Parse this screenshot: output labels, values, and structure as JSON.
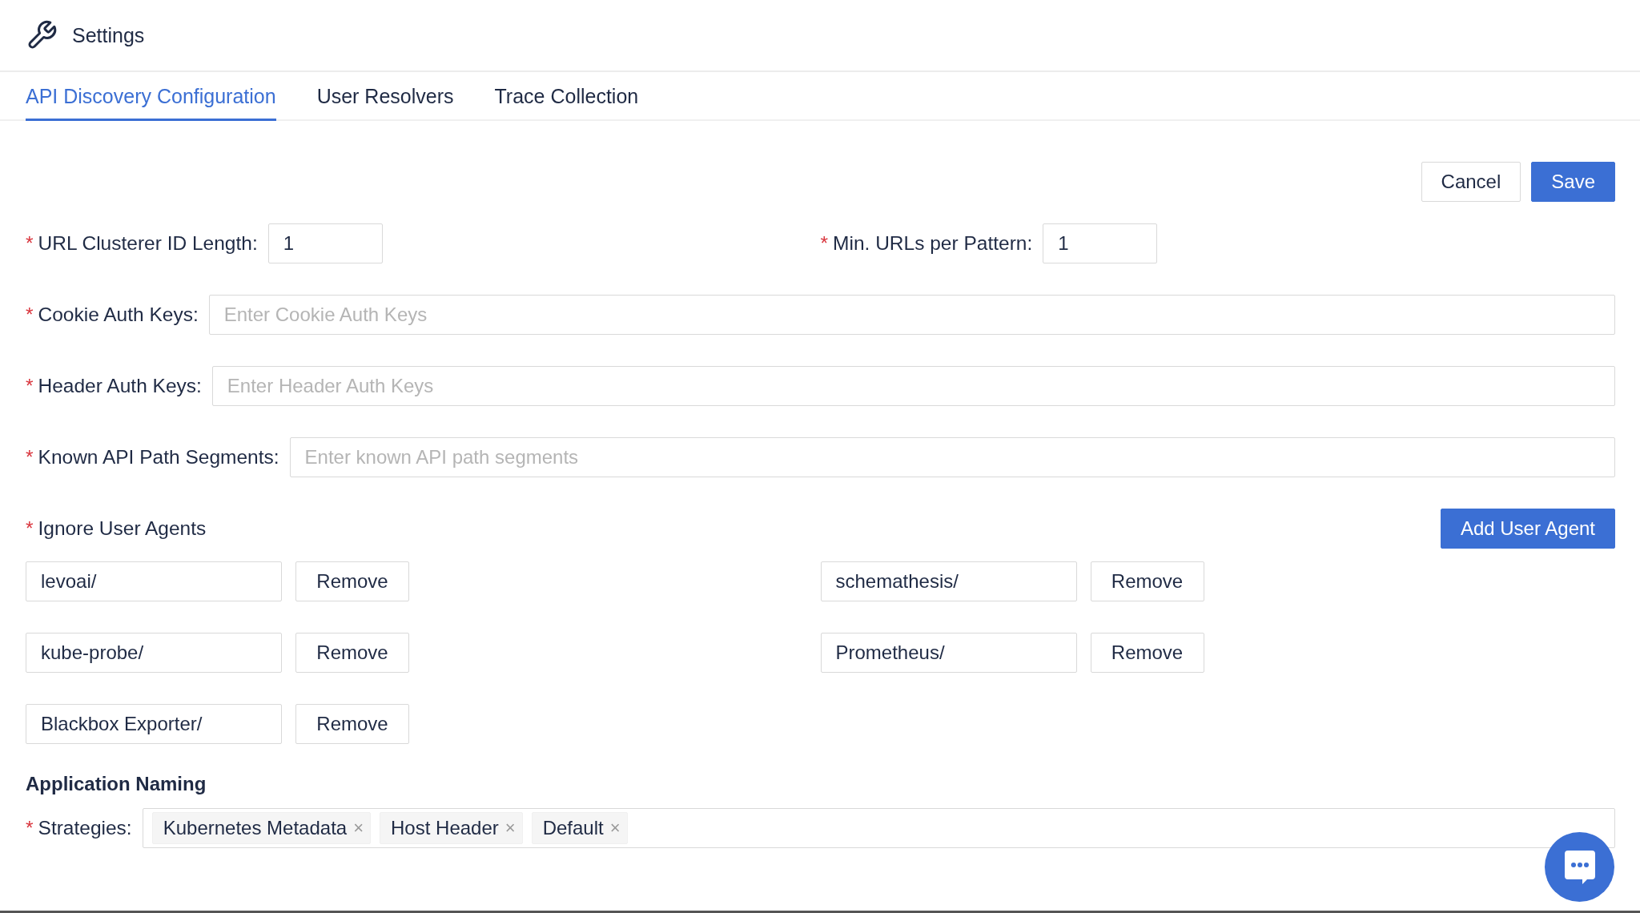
{
  "header": {
    "title": "Settings"
  },
  "tabs": [
    {
      "label": "API Discovery Configuration",
      "selected": true
    },
    {
      "label": "User Resolvers",
      "selected": false
    },
    {
      "label": "Trace Collection",
      "selected": false
    }
  ],
  "actions": {
    "cancel": "Cancel",
    "save": "Save"
  },
  "required_mark": "*",
  "field_rows": [
    [
      {
        "label": "URL Clusterer ID Length:",
        "required": true,
        "kind": "short",
        "value": "1"
      },
      {
        "label": "Min. URLs per Pattern:",
        "required": true,
        "kind": "short",
        "value": "1"
      }
    ],
    [
      {
        "label": "Cookie Auth Keys:",
        "required": true,
        "kind": "wide",
        "placeholder": "Enter Cookie Auth Keys"
      }
    ],
    [
      {
        "label": "Header Auth Keys:",
        "required": true,
        "kind": "wide",
        "placeholder": "Enter Header Auth Keys"
      }
    ],
    [
      {
        "label": "Known API Path Segments:",
        "required": true,
        "kind": "wide",
        "placeholder": "Enter known API path segments"
      }
    ]
  ],
  "user_agents": {
    "label": "Ignore User Agents",
    "required": true,
    "add_button": "Add User Agent",
    "agents": [
      {
        "value": "levoai/",
        "remove": "Remove"
      },
      {
        "value": "schemathesis/",
        "remove": "Remove"
      },
      {
        "value": "kube-probe/",
        "remove": "Remove"
      },
      {
        "value": "Prometheus/",
        "remove": "Remove"
      },
      {
        "value": "Blackbox Exporter/",
        "remove": "Remove"
      }
    ]
  },
  "naming": {
    "heading": "Application Naming",
    "label": "Strategies:",
    "required": true,
    "tags": [
      {
        "label": "Kubernetes Metadata",
        "remove": "×"
      },
      {
        "label": "Host Header",
        "remove": "×"
      },
      {
        "label": "Default",
        "remove": "×"
      }
    ]
  }
}
